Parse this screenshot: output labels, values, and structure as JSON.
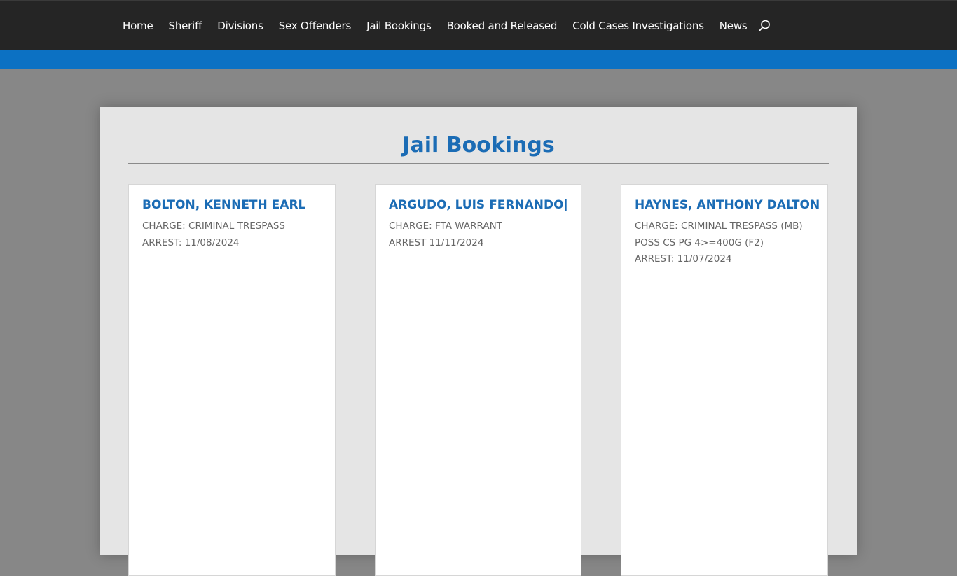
{
  "nav": {
    "items": [
      {
        "label": "Home"
      },
      {
        "label": "Sheriff"
      },
      {
        "label": "Divisions"
      },
      {
        "label": "Sex Offenders"
      },
      {
        "label": "Jail Bookings"
      },
      {
        "label": "Booked and Released"
      },
      {
        "label": "Cold Cases Investigations"
      },
      {
        "label": "News"
      }
    ],
    "search_icon": "search-icon"
  },
  "colors": {
    "topbar": "#252525",
    "accent_bar": "#0c71c3",
    "title": "#1b6cb5",
    "page_bg": "#878787",
    "panel_bg": "#e5e5e5"
  },
  "page": {
    "title": "Jail Bookings"
  },
  "bookings": [
    {
      "name": "BOLTON, KENNETH EARL",
      "lines": [
        "CHARGE: CRIMINAL TRESPASS",
        "ARREST: 11/08/2024"
      ]
    },
    {
      "name": "ARGUDO, LUIS FERNANDO|",
      "lines": [
        "CHARGE: FTA WARRANT",
        "ARREST 11/11/2024"
      ]
    },
    {
      "name": "HAYNES, ANTHONY DALTON",
      "lines": [
        "CHARGE: CRIMINAL TRESPASS (MB)",
        "POSS CS PG 4>=400G (F2)",
        "ARREST: 11/07/2024"
      ]
    }
  ]
}
